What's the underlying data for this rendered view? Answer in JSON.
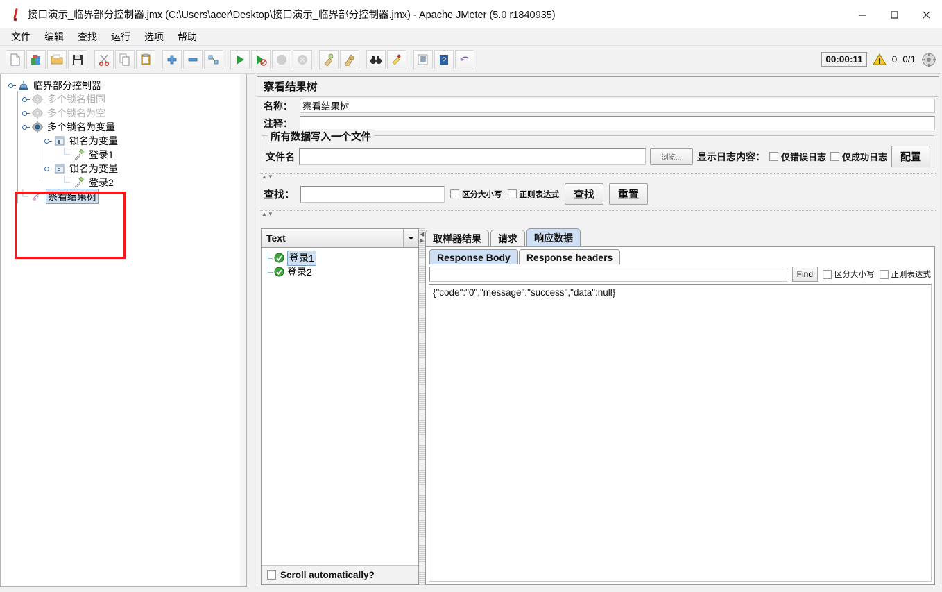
{
  "window": {
    "title": "接口演示_临界部分控制器.jmx (C:\\Users\\acer\\Desktop\\接口演示_临界部分控制器.jmx) - Apache JMeter (5.0 r1840935)",
    "app_icon": "jmeter-feather-icon",
    "minimize_label": "—",
    "maximize_label": "▢",
    "close_label": "✕"
  },
  "menu": {
    "items": [
      {
        "label": "文件",
        "name": "menu-file"
      },
      {
        "label": "编辑",
        "name": "menu-edit"
      },
      {
        "label": "查找",
        "name": "menu-search"
      },
      {
        "label": "运行",
        "name": "menu-run"
      },
      {
        "label": "选项",
        "name": "menu-options"
      },
      {
        "label": "帮助",
        "name": "menu-help"
      }
    ]
  },
  "toolbar": {
    "buttons": [
      {
        "name": "new-button",
        "icon": "new-document-icon"
      },
      {
        "name": "templates-button",
        "icon": "templates-icon"
      },
      {
        "name": "open-button",
        "icon": "open-folder-icon"
      },
      {
        "name": "save-button",
        "icon": "save-disk-icon"
      },
      {
        "name": "cut-button",
        "icon": "scissors-icon"
      },
      {
        "name": "copy-button",
        "icon": "copy-icon"
      },
      {
        "name": "paste-button",
        "icon": "clipboard-paste-icon"
      },
      {
        "name": "expand-all-button",
        "icon": "plus-icon"
      },
      {
        "name": "collapse-all-button",
        "icon": "minus-icon"
      },
      {
        "name": "toggle-button",
        "icon": "toggle-icon"
      },
      {
        "name": "start-button",
        "icon": "play-green-icon"
      },
      {
        "name": "start-no-pauses-button",
        "icon": "play-no-pause-icon"
      },
      {
        "name": "stop-button",
        "icon": "stop-icon"
      },
      {
        "name": "shutdown-button",
        "icon": "shutdown-icon"
      },
      {
        "name": "clear-button",
        "icon": "clear-broom-icon"
      },
      {
        "name": "clear-all-button",
        "icon": "clear-all-broom-icon"
      },
      {
        "name": "search-button",
        "icon": "binoculars-icon"
      },
      {
        "name": "reset-search-button",
        "icon": "reset-search-icon"
      },
      {
        "name": "function-helper-button",
        "icon": "function-list-icon"
      },
      {
        "name": "help-button",
        "icon": "help-book-icon"
      },
      {
        "name": "undo-redo-button",
        "icon": "undo-icon"
      }
    ],
    "timer": "00:00:11",
    "warning_icon": "warning-triangle-icon",
    "warning_count": "0",
    "thread_count": "0/1",
    "activity_icon": "activity-circle-icon"
  },
  "tree": {
    "nodes": [
      {
        "label": "临界部分控制器",
        "name": "tree-node-critical-section-controller",
        "icon": "test-plan-icon",
        "depth": 0,
        "disabled": false,
        "selected": false,
        "expandable": true
      },
      {
        "label": "多个锁名相同",
        "name": "tree-node-same-lock-names",
        "icon": "gear-gray-icon",
        "depth": 1,
        "disabled": true,
        "selected": false,
        "expandable": true
      },
      {
        "label": "多个锁名为空",
        "name": "tree-node-empty-lock-names",
        "icon": "gear-gray-icon",
        "depth": 1,
        "disabled": true,
        "selected": false,
        "expandable": true
      },
      {
        "label": "多个锁名为变量",
        "name": "tree-node-variable-lock-names",
        "icon": "gear-blue-icon",
        "depth": 1,
        "disabled": false,
        "selected": false,
        "expandable": true
      },
      {
        "label": "锁名为变量",
        "name": "tree-node-lock-name-variable-1",
        "icon": "controller-icon",
        "depth": 2,
        "disabled": false,
        "selected": false,
        "expandable": true
      },
      {
        "label": "登录1",
        "name": "tree-node-login-1",
        "icon": "sampler-icon",
        "depth": 3,
        "disabled": false,
        "selected": false,
        "expandable": false
      },
      {
        "label": "锁名为变量",
        "name": "tree-node-lock-name-variable-2",
        "icon": "controller-icon",
        "depth": 2,
        "disabled": false,
        "selected": false,
        "expandable": true
      },
      {
        "label": "登录2",
        "name": "tree-node-login-2",
        "icon": "sampler-icon",
        "depth": 3,
        "disabled": false,
        "selected": false,
        "expandable": false
      },
      {
        "label": "察看结果树",
        "name": "tree-node-view-results-tree",
        "icon": "view-results-tree-icon",
        "depth": 1,
        "disabled": false,
        "selected": true,
        "expandable": false
      }
    ],
    "highlight_color": "#f41a1a"
  },
  "panel": {
    "header": "察看结果树",
    "name_label": "名称：",
    "name_value": "察看结果树",
    "comment_label": "注释：",
    "comment_value": "",
    "file_group": {
      "legend": "所有数据写入一个文件",
      "filename_label": "文件名",
      "filename_value": "",
      "browse_button": "浏览...",
      "log_display_label": "显示日志内容：",
      "errors_only_label": "仅错误日志",
      "errors_only_checked": false,
      "success_only_label": "仅成功日志",
      "success_only_checked": false,
      "configure_button": "配置"
    },
    "search": {
      "label": "查找：",
      "value": "",
      "case_sensitive_label": "区分大小写",
      "case_sensitive_checked": false,
      "regex_label": "正则表达式",
      "regex_checked": false,
      "search_button": "查找",
      "reset_button": "重置"
    },
    "results": {
      "renderer": "Text",
      "items": [
        {
          "label": "登录1",
          "name": "result-item-login-1",
          "status": "success",
          "selected": true
        },
        {
          "label": "登录2",
          "name": "result-item-login-2",
          "status": "success",
          "selected": false
        }
      ],
      "scroll_auto_label": "Scroll automatically?",
      "scroll_auto_checked": false
    },
    "tabs": [
      {
        "label": "取样器结果",
        "name": "tab-sampler-result",
        "active": false
      },
      {
        "label": "请求",
        "name": "tab-request",
        "active": false
      },
      {
        "label": "响应数据",
        "name": "tab-response-data",
        "active": true
      }
    ],
    "subtabs": [
      {
        "label": "Response Body",
        "name": "subtab-response-body",
        "active": true
      },
      {
        "label": "Response headers",
        "name": "subtab-response-headers",
        "active": false
      }
    ],
    "find": {
      "value": "",
      "find_button": "Find",
      "case_sensitive_label": "区分大小写",
      "case_sensitive_checked": false,
      "regex_label": "正则表达式",
      "regex_checked": false
    },
    "response_body": "{\"code\":\"0\",\"message\":\"success\",\"data\":null}"
  }
}
